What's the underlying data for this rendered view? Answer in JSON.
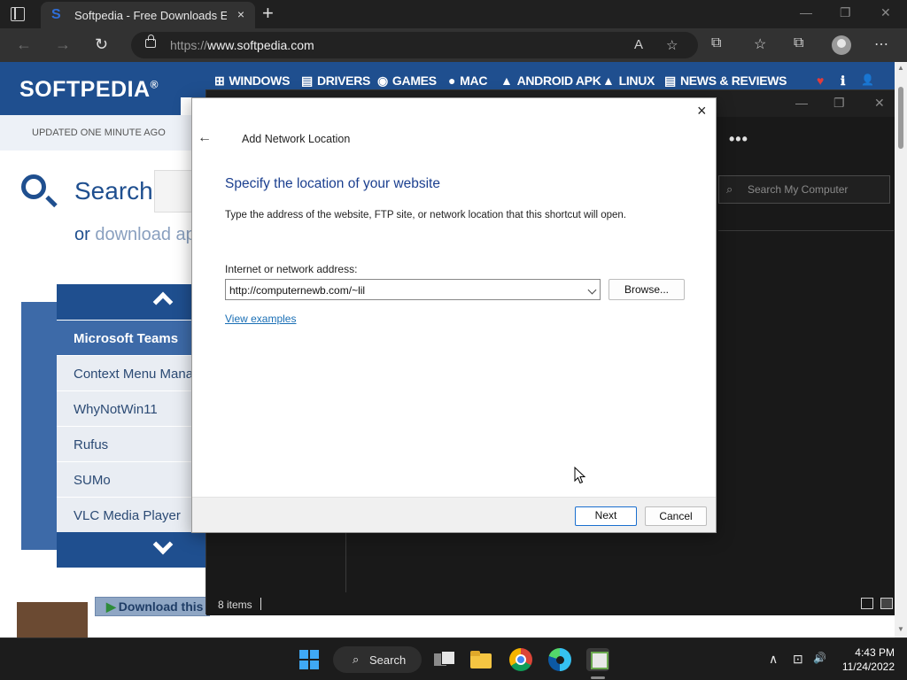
{
  "browser": {
    "tab_title": "Softpedia - Free Downloads Enc",
    "tab_favicon": "S",
    "url_prefix": "https://",
    "url_domain": "www.softpedia.com",
    "icons": {
      "tab_actions": "tab-actions-icon",
      "close": "×",
      "new_tab": "+",
      "back": "←",
      "forward": "→",
      "reload": "↻",
      "read_aloud": "A",
      "favorites_add": "☆",
      "extensions": "⧉",
      "favorites": "☆",
      "collections": "⧉",
      "more": "⋯",
      "minimize": "—",
      "maximize": "❐",
      "window_close": "✕"
    }
  },
  "page": {
    "logo": "SOFTPEDIA",
    "logo_mark": "®",
    "nav": [
      {
        "icon": "⊞",
        "label": "WINDOWS"
      },
      {
        "icon": "▤",
        "label": "DRIVERS"
      },
      {
        "icon": "◉",
        "label": "GAMES"
      },
      {
        "icon": "●",
        "label": "MAC"
      },
      {
        "icon": "▲",
        "label": "ANDROID APK"
      },
      {
        "icon": "▲",
        "label": "LINUX"
      },
      {
        "icon": "▤",
        "label": "NEWS & REVIEWS"
      }
    ],
    "nav_right_icons": {
      "heart": "♥",
      "info": "ℹ",
      "user": "👤"
    },
    "updated": "UPDATED ONE MINUTE AGO",
    "search_label": "Search",
    "or_text": "or",
    "or_link": "download app",
    "list": [
      {
        "label": "Microsoft Teams",
        "active": true
      },
      {
        "label": "Context Menu Manage"
      },
      {
        "label": "WhyNotWin11"
      },
      {
        "label": "Rufus"
      },
      {
        "label": "SUMo"
      },
      {
        "label": "VLC Media Player"
      }
    ],
    "download_button": "Download this"
  },
  "explorer": {
    "more": "•••",
    "search_placeholder": "Search My Computer",
    "items_count": "8 items"
  },
  "dialog": {
    "close": "×",
    "back": "←",
    "title": "Add Network Location",
    "heading": "Specify the location of your website",
    "description": "Type the address of the website, FTP site, or network location that this shortcut will open.",
    "address_label": "Internet or network address:",
    "address_value": "http://computernewb.com/~lil",
    "browse": "Browse...",
    "view_examples": "View examples",
    "next": "Next",
    "cancel": "Cancel"
  },
  "taskbar": {
    "search_label": "Search",
    "search_icon": "⌕",
    "tray": {
      "chevron": "∧",
      "network": "⊡",
      "volume": "🔊"
    },
    "time": "4:43 PM",
    "date": "11/24/2022"
  },
  "colors": {
    "brand_blue": "#1f4f8f",
    "dialog_heading": "#1b3f8f",
    "link": "#1a6fb5",
    "next_border": "#1a6fcf"
  }
}
